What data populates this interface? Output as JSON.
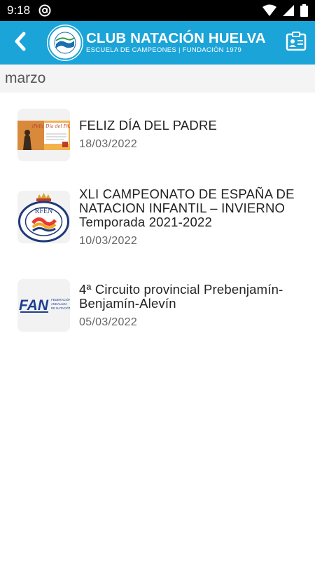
{
  "status_bar": {
    "time": "9:18",
    "icons": [
      "at-sign-notification-icon",
      "wifi-icon",
      "signal-icon",
      "battery-icon"
    ]
  },
  "app_bar": {
    "back_icon": "chevron-left-icon",
    "club_name": "CLUB NATACIÓN HUELVA",
    "club_tagline": "ESCUELA DE CAMPEONES | FUNDACIÓN 1979",
    "crest_text": "CLUB NATACIÓN HUELVA",
    "profile_icon": "id-card-icon",
    "background_color": "#1ba4d8"
  },
  "month_header": "marzo",
  "news": [
    {
      "title": "FELIZ DÍA DEL PADRE",
      "date": "18/03/2022",
      "thumb_text": "¡Feliz Día del PADRE!"
    },
    {
      "title": "XLI CAMPEONATO DE ESPAÑA DE NATACION INFANTIL – INVIERNO Temporada 2021-2022",
      "date": "10/03/2022",
      "thumb_text": "RFEN"
    },
    {
      "title": "4ª Circuito provincial Prebenjamín-Benjamín-Alevín",
      "date": "05/03/2022",
      "thumb_text": "FAN",
      "thumb_subtext": "FEDERACIÓN ANDALUZA DE NATACIÓN"
    }
  ]
}
